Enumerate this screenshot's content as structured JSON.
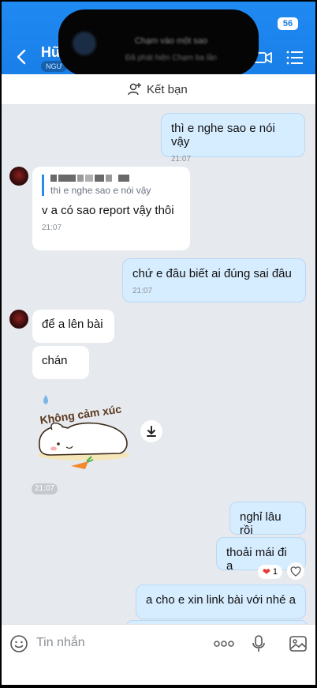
{
  "header": {
    "title": "Hữ",
    "subtitle": "NGƯ",
    "status_badge": "56"
  },
  "notification": {
    "title": "Chạm vào một sao",
    "subtitle": "Đã phát hiện Chạm ba lần"
  },
  "friend_bar": {
    "label": "Kết bạn"
  },
  "messages": {
    "m1": {
      "text": "thì e nghe sao e nói vậy",
      "time": "21:07"
    },
    "m2": {
      "quote": "thì e nghe sao e nói vậy",
      "text": "v a có sao report vậy thôi",
      "time": "21:07"
    },
    "m3": {
      "text": "chứ e đâu biết ai đúng sai đâu",
      "time": "21:07"
    },
    "m4": {
      "text": "để a lên bài"
    },
    "m5": {
      "text": "chán"
    },
    "sticker": {
      "caption": "Không cảm xúc",
      "time": "21:07"
    },
    "m6": {
      "text": "nghỉ lâu rồi"
    },
    "m7": {
      "text": "thoải mái đi a",
      "reaction_count": "1"
    },
    "m8": {
      "text": "a cho e xin link bài với nhé a"
    }
  },
  "input": {
    "placeholder": "Tin nhắn"
  },
  "colors": {
    "accent": "#1a7fe8",
    "mine_bubble": "#d6ecff",
    "background": "#e6e9ee"
  }
}
